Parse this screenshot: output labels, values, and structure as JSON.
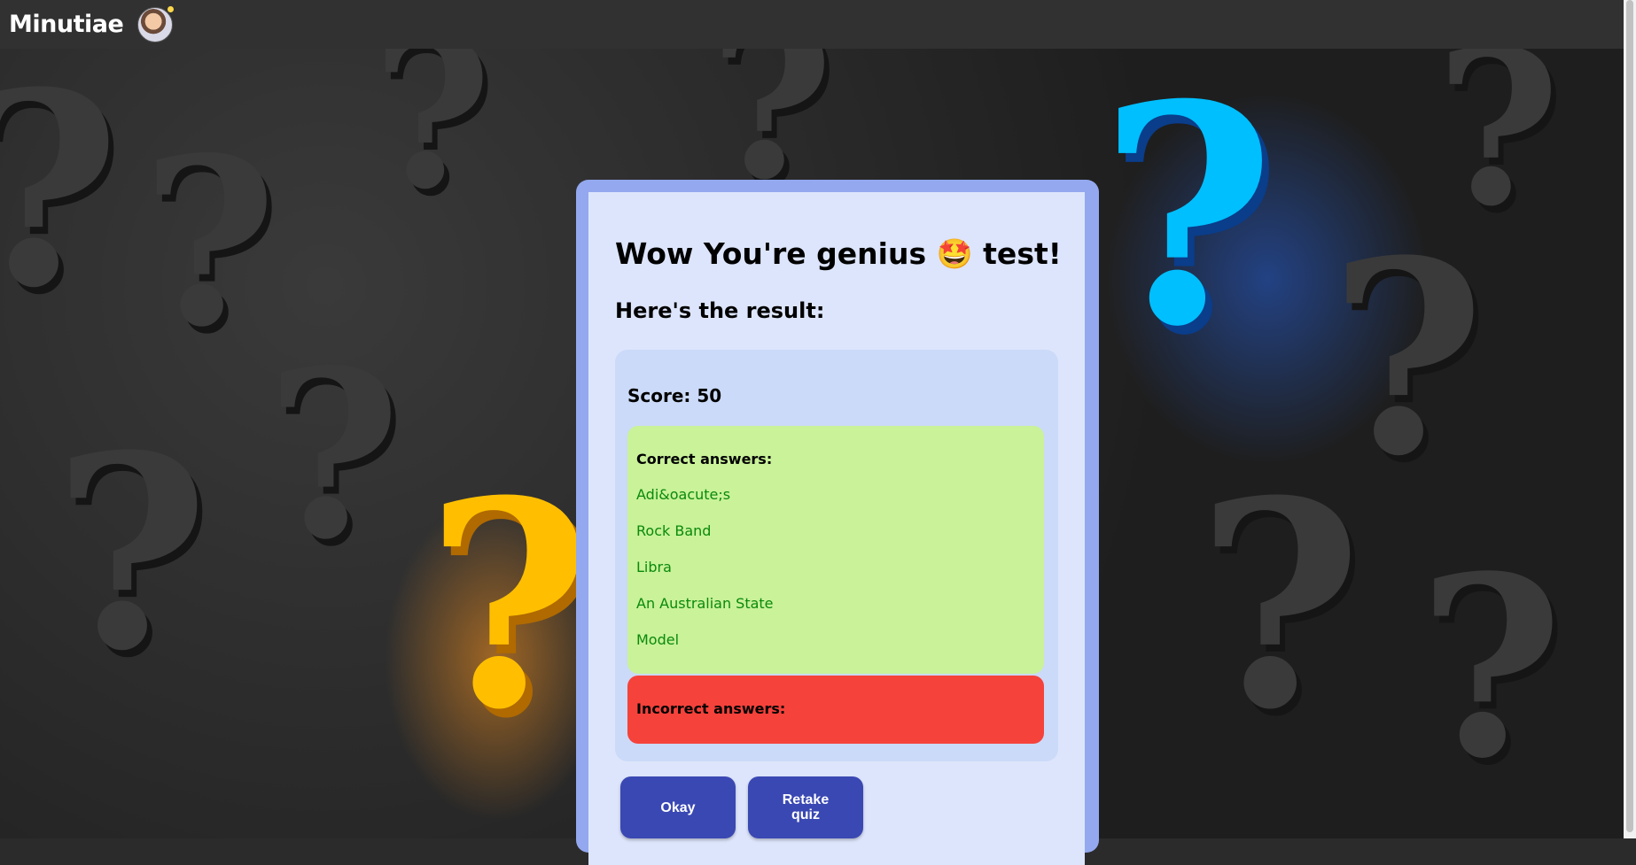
{
  "header": {
    "brand": "Minutiae"
  },
  "result": {
    "title": "Wow You're genius 🤩 test!",
    "subtitle": "Here's the result:",
    "score_label": "Score: 50",
    "correct_heading": "Correct answers:",
    "correct_answers": [
      "Adi&oacute;s",
      "Rock Band",
      "Libra",
      "An Australian State",
      "Model"
    ],
    "incorrect_heading": "Incorrect answers:"
  },
  "buttons": {
    "okay": "Okay",
    "retake": "Retake quiz"
  },
  "colors": {
    "modal_border": "#93a8ef",
    "modal_bg": "#dde5fc",
    "correct_bg": "#c9f299",
    "correct_text": "#0a8a0a",
    "incorrect_bg": "#f5423b",
    "button_bg": "#3a48b3"
  }
}
